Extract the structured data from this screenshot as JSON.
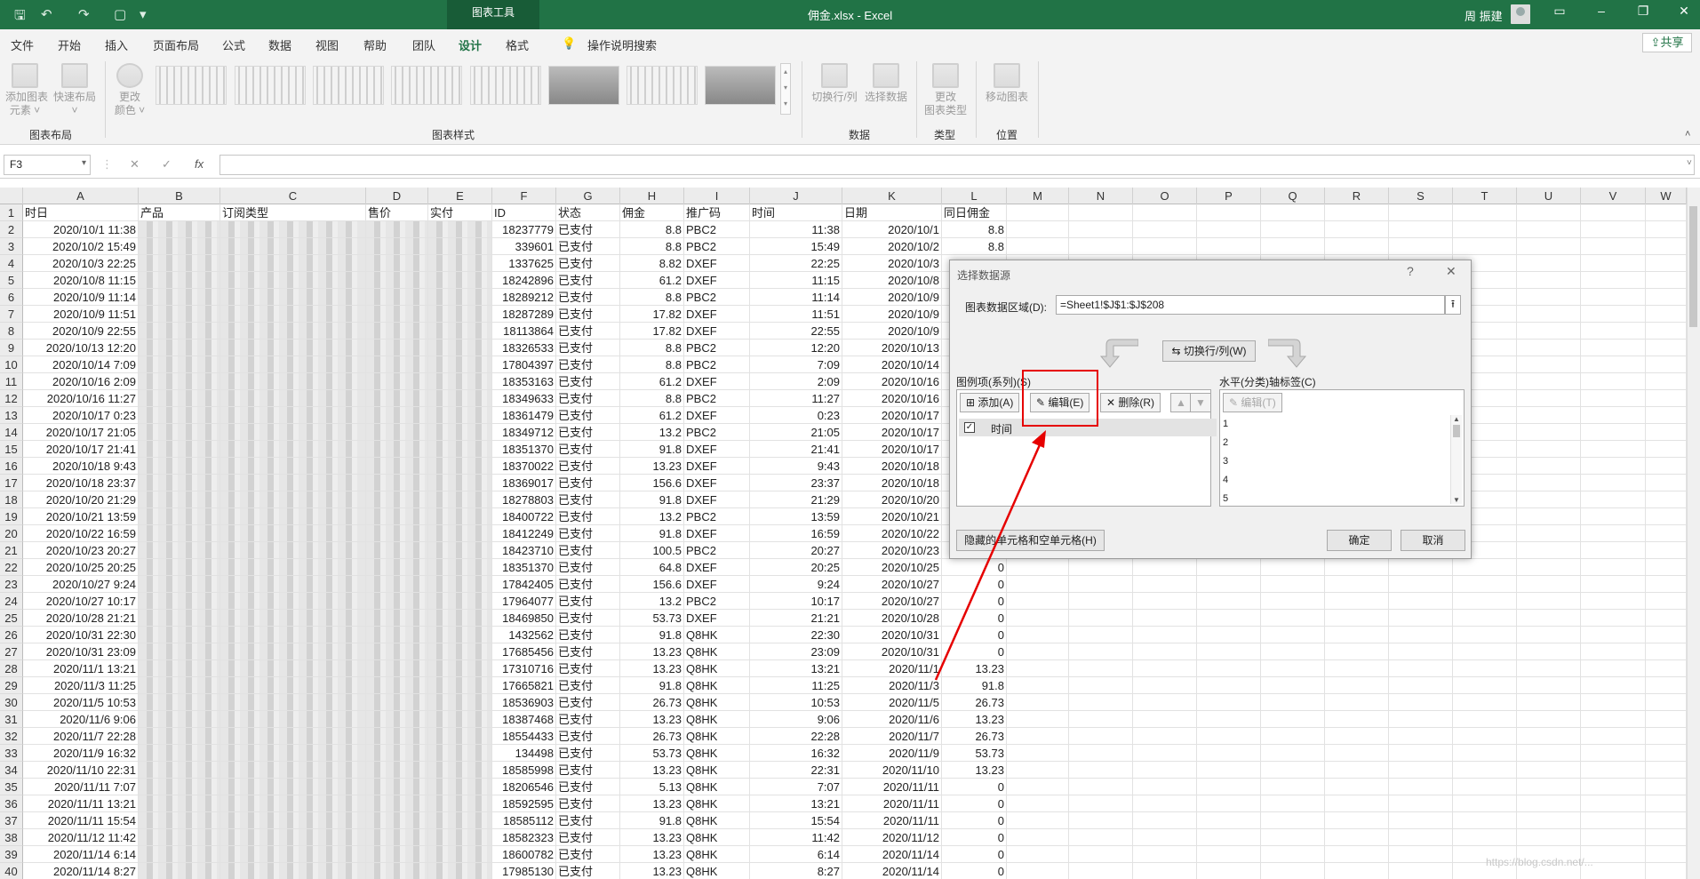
{
  "titlebar": {
    "context_tab": "图表工具",
    "doc_title": "佣金.xlsx  -  Excel",
    "user": "周 振建"
  },
  "menu": {
    "tabs": [
      "文件",
      "开始",
      "插入",
      "页面布局",
      "公式",
      "数据",
      "视图",
      "帮助",
      "团队",
      "设计",
      "格式"
    ],
    "active": "设计",
    "tell_me": "操作说明搜索",
    "share": "共享"
  },
  "ribbon": {
    "btn_add_element": "添加图表\n元素 ˅",
    "btn_quick_layout": "快速布局\n˅",
    "btn_change_color": "更改\n颜色 ˅",
    "btn_switch": "切换行/列",
    "btn_select_data": "选择数据",
    "btn_change_type": "更改\n图表类型",
    "btn_move": "移动图表",
    "group_layout": "图表布局",
    "group_styles": "图表样式",
    "group_data": "数据",
    "group_type": "类型",
    "group_position": "位置"
  },
  "formula": {
    "namebox": "F3",
    "fx": "fx",
    "cancel": "✕",
    "enter": "✓"
  },
  "columns": [
    "A",
    "B",
    "C",
    "D",
    "E",
    "F",
    "G",
    "H",
    "I",
    "J",
    "K",
    "L",
    "M",
    "N",
    "O",
    "P",
    "Q",
    "R",
    "S",
    "T",
    "U",
    "V",
    "W"
  ],
  "headers": {
    "A": "时日",
    "B": "产品",
    "C": "订阅类型",
    "D": "售价",
    "E": "实付",
    "F": "ID",
    "G": "状态",
    "H": "佣金",
    "I": "推广码",
    "J": "时间",
    "K": "日期",
    "L": "同日佣金"
  },
  "rows": [
    [
      "2020/10/1 11:38",
      "18237779",
      "已支付",
      "8.8",
      "PBC2",
      "11:38",
      "2020/10/1",
      "8.8"
    ],
    [
      "2020/10/2 15:49",
      "339601",
      "已支付",
      "8.8",
      "PBC2",
      "15:49",
      "2020/10/2",
      "8.8"
    ],
    [
      "2020/10/3 22:25",
      "1337625",
      "已支付",
      "8.82",
      "DXEF",
      "22:25",
      "2020/10/3",
      ""
    ],
    [
      "2020/10/8 11:15",
      "18242896",
      "已支付",
      "61.2",
      "DXEF",
      "11:15",
      "2020/10/8",
      ""
    ],
    [
      "2020/10/9 11:14",
      "18289212",
      "已支付",
      "8.8",
      "PBC2",
      "11:14",
      "2020/10/9",
      ""
    ],
    [
      "2020/10/9 11:51",
      "18287289",
      "已支付",
      "17.82",
      "DXEF",
      "11:51",
      "2020/10/9",
      ""
    ],
    [
      "2020/10/9 22:55",
      "18113864",
      "已支付",
      "17.82",
      "DXEF",
      "22:55",
      "2020/10/9",
      ""
    ],
    [
      "2020/10/13 12:20",
      "18326533",
      "已支付",
      "8.8",
      "PBC2",
      "12:20",
      "2020/10/13",
      ""
    ],
    [
      "2020/10/14 7:09",
      "17804397",
      "已支付",
      "8.8",
      "PBC2",
      "7:09",
      "2020/10/14",
      ""
    ],
    [
      "2020/10/16 2:09",
      "18353163",
      "已支付",
      "61.2",
      "DXEF",
      "2:09",
      "2020/10/16",
      ""
    ],
    [
      "2020/10/16 11:27",
      "18349633",
      "已支付",
      "8.8",
      "PBC2",
      "11:27",
      "2020/10/16",
      ""
    ],
    [
      "2020/10/17 0:23",
      "18361479",
      "已支付",
      "61.2",
      "DXEF",
      "0:23",
      "2020/10/17",
      ""
    ],
    [
      "2020/10/17 21:05",
      "18349712",
      "已支付",
      "13.2",
      "PBC2",
      "21:05",
      "2020/10/17",
      ""
    ],
    [
      "2020/10/17 21:41",
      "18351370",
      "已支付",
      "91.8",
      "DXEF",
      "21:41",
      "2020/10/17",
      ""
    ],
    [
      "2020/10/18 9:43",
      "18370022",
      "已支付",
      "13.23",
      "DXEF",
      "9:43",
      "2020/10/18",
      ""
    ],
    [
      "2020/10/18 23:37",
      "18369017",
      "已支付",
      "156.6",
      "DXEF",
      "23:37",
      "2020/10/18",
      ""
    ],
    [
      "2020/10/20 21:29",
      "18278803",
      "已支付",
      "91.8",
      "DXEF",
      "21:29",
      "2020/10/20",
      ""
    ],
    [
      "2020/10/21 13:59",
      "18400722",
      "已支付",
      "13.2",
      "PBC2",
      "13:59",
      "2020/10/21",
      ""
    ],
    [
      "2020/10/22 16:59",
      "18412249",
      "已支付",
      "91.8",
      "DXEF",
      "16:59",
      "2020/10/22",
      ""
    ],
    [
      "2020/10/23 20:27",
      "18423710",
      "已支付",
      "100.5",
      "PBC2",
      "20:27",
      "2020/10/23",
      ""
    ],
    [
      "2020/10/25 20:25",
      "18351370",
      "已支付",
      "64.8",
      "DXEF",
      "20:25",
      "2020/10/25",
      "0"
    ],
    [
      "2020/10/27 9:24",
      "17842405",
      "已支付",
      "156.6",
      "DXEF",
      "9:24",
      "2020/10/27",
      "0"
    ],
    [
      "2020/10/27 10:17",
      "17964077",
      "已支付",
      "13.2",
      "PBC2",
      "10:17",
      "2020/10/27",
      "0"
    ],
    [
      "2020/10/28 21:21",
      "18469850",
      "已支付",
      "53.73",
      "DXEF",
      "21:21",
      "2020/10/28",
      "0"
    ],
    [
      "2020/10/31 22:30",
      "1432562",
      "已支付",
      "91.8",
      "Q8HK",
      "22:30",
      "2020/10/31",
      "0"
    ],
    [
      "2020/10/31 23:09",
      "17685456",
      "已支付",
      "13.23",
      "Q8HK",
      "23:09",
      "2020/10/31",
      "0"
    ],
    [
      "2020/11/1 13:21",
      "17310716",
      "已支付",
      "13.23",
      "Q8HK",
      "13:21",
      "2020/11/1",
      "13.23"
    ],
    [
      "2020/11/3 11:25",
      "17665821",
      "已支付",
      "91.8",
      "Q8HK",
      "11:25",
      "2020/11/3",
      "91.8"
    ],
    [
      "2020/11/5 10:53",
      "18536903",
      "已支付",
      "26.73",
      "Q8HK",
      "10:53",
      "2020/11/5",
      "26.73"
    ],
    [
      "2020/11/6 9:06",
      "18387468",
      "已支付",
      "13.23",
      "Q8HK",
      "9:06",
      "2020/11/6",
      "13.23"
    ],
    [
      "2020/11/7 22:28",
      "18554433",
      "已支付",
      "26.73",
      "Q8HK",
      "22:28",
      "2020/11/7",
      "26.73"
    ],
    [
      "2020/11/9 16:32",
      "134498",
      "已支付",
      "53.73",
      "Q8HK",
      "16:32",
      "2020/11/9",
      "53.73"
    ],
    [
      "2020/11/10 22:31",
      "18585998",
      "已支付",
      "13.23",
      "Q8HK",
      "22:31",
      "2020/11/10",
      "13.23"
    ],
    [
      "2020/11/11 7:07",
      "18206546",
      "已支付",
      "5.13",
      "Q8HK",
      "7:07",
      "2020/11/11",
      "0"
    ],
    [
      "2020/11/11 13:21",
      "18592595",
      "已支付",
      "13.23",
      "Q8HK",
      "13:21",
      "2020/11/11",
      "0"
    ],
    [
      "2020/11/11 15:54",
      "18585112",
      "已支付",
      "91.8",
      "Q8HK",
      "15:54",
      "2020/11/11",
      "0"
    ],
    [
      "2020/11/12 11:42",
      "18582323",
      "已支付",
      "13.23",
      "Q8HK",
      "11:42",
      "2020/11/12",
      "0"
    ],
    [
      "2020/11/14 6:14",
      "18600782",
      "已支付",
      "13.23",
      "Q8HK",
      "6:14",
      "2020/11/14",
      "0"
    ],
    [
      "2020/11/14 8:27",
      "17985130",
      "已支付",
      "13.23",
      "Q8HK",
      "8:27",
      "2020/11/14",
      "0"
    ]
  ],
  "dialog": {
    "title": "选择数据源",
    "help": "?",
    "close": "✕",
    "range_label": "图表数据区域(D):",
    "range_value": "=Sheet1!$J$1:$J$208",
    "switch": "切换行/列(W)",
    "series_label": "图例项(系列)(S)",
    "add": "添加(A)",
    "edit": "编辑(E)",
    "remove": "删除(R)",
    "series": [
      {
        "name": "时间",
        "checked": true
      }
    ],
    "axis_label": "水平(分类)轴标签(C)",
    "axis_edit": "编辑(T)",
    "axis_items": [
      "1",
      "2",
      "3",
      "4",
      "5"
    ],
    "hidden_cells": "隐藏的单元格和空单元格(H)",
    "ok": "确定",
    "cancel": "取消"
  },
  "watermark": "https://blog.csdn.net/..."
}
